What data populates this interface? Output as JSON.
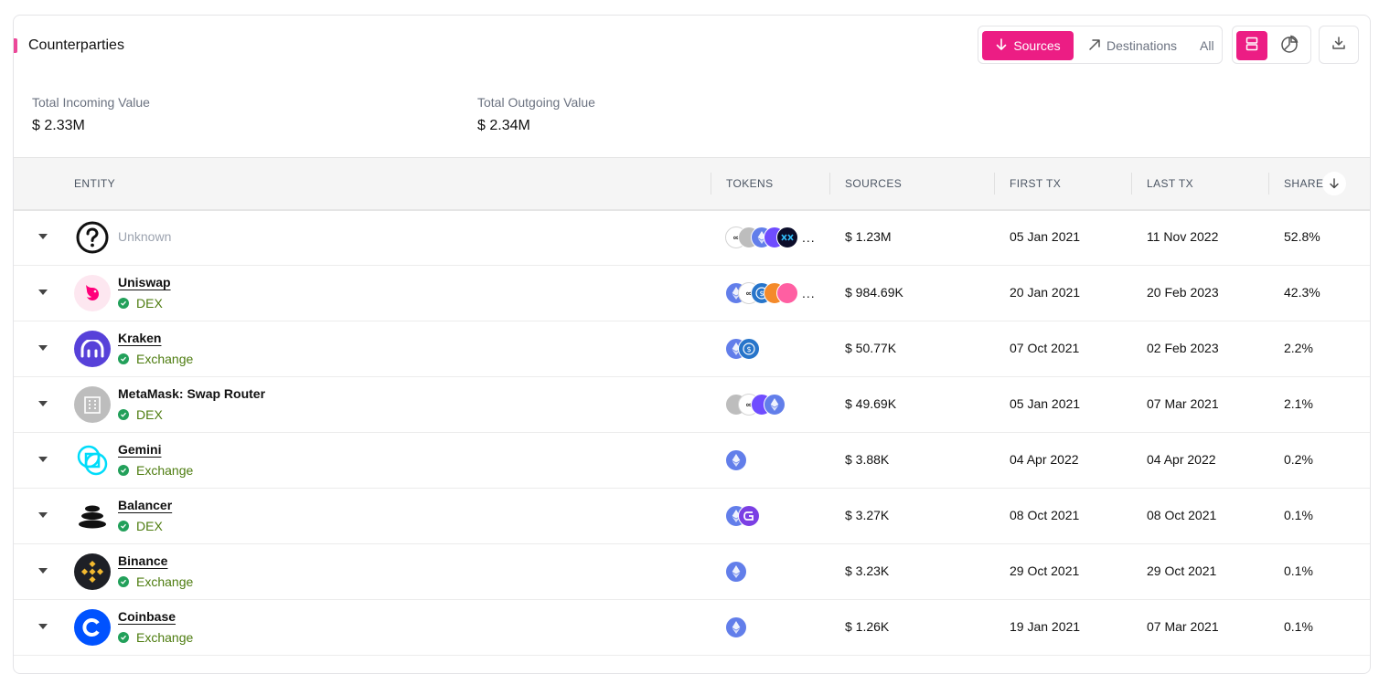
{
  "header": {
    "title": "Counterparties",
    "toggle": {
      "sources": "Sources",
      "destinations": "Destinations",
      "all": "All"
    },
    "accent_color": "#ec1d84"
  },
  "summary": {
    "incoming_label": "Total Incoming Value",
    "incoming_value": "$ 2.33M",
    "outgoing_label": "Total Outgoing Value",
    "outgoing_value": "$ 2.34M"
  },
  "table": {
    "columns": {
      "entity": "ENTITY",
      "tokens": "TOKENS",
      "sources": "SOURCES",
      "first_tx": "FIRST TX",
      "last_tx": "LAST TX",
      "share": "SHARE"
    },
    "sort": "share-descending",
    "rows": [
      {
        "name": "Unknown",
        "type": "",
        "tokens": [
          "link",
          "gray",
          "eth",
          "grt",
          "dark"
        ],
        "more": "...",
        "sources": "$ 1.23M",
        "first_tx": "05 Jan 2021",
        "last_tx": "11 Nov 2022",
        "share": "52.8%"
      },
      {
        "name": "Uniswap",
        "type": "DEX",
        "tokens": [
          "eth",
          "link",
          "usdc",
          "orange",
          "pink"
        ],
        "more": "...",
        "sources": "$ 984.69K",
        "first_tx": "20 Jan 2021",
        "last_tx": "20 Feb 2023",
        "share": "42.3%"
      },
      {
        "name": "Kraken",
        "type": "Exchange",
        "tokens": [
          "eth",
          "usdc"
        ],
        "more": "",
        "sources": "$ 50.77K",
        "first_tx": "07 Oct 2021",
        "last_tx": "02 Feb 2023",
        "share": "2.2%"
      },
      {
        "name": "MetaMask: Swap Router",
        "type": "DEX",
        "tokens": [
          "gray",
          "link",
          "grt",
          "eth"
        ],
        "more": "",
        "sources": "$ 49.69K",
        "first_tx": "05 Jan 2021",
        "last_tx": "07 Mar 2021",
        "share": "2.1%"
      },
      {
        "name": "Gemini",
        "type": "Exchange",
        "tokens": [
          "eth"
        ],
        "more": "",
        "sources": "$ 3.88K",
        "first_tx": "04 Apr 2022",
        "last_tx": "04 Apr 2022",
        "share": "0.2%"
      },
      {
        "name": "Balancer",
        "type": "DEX",
        "tokens": [
          "eth",
          "purple"
        ],
        "more": "",
        "sources": "$ 3.27K",
        "first_tx": "08 Oct 2021",
        "last_tx": "08 Oct 2021",
        "share": "0.1%"
      },
      {
        "name": "Binance",
        "type": "Exchange",
        "tokens": [
          "eth"
        ],
        "more": "",
        "sources": "$ 3.23K",
        "first_tx": "29 Oct 2021",
        "last_tx": "29 Oct 2021",
        "share": "0.1%"
      },
      {
        "name": "Coinbase",
        "type": "Exchange",
        "tokens": [
          "eth"
        ],
        "more": "",
        "sources": "$ 1.26K",
        "first_tx": "19 Jan 2021",
        "last_tx": "07 Mar 2021",
        "share": "0.1%"
      }
    ]
  }
}
